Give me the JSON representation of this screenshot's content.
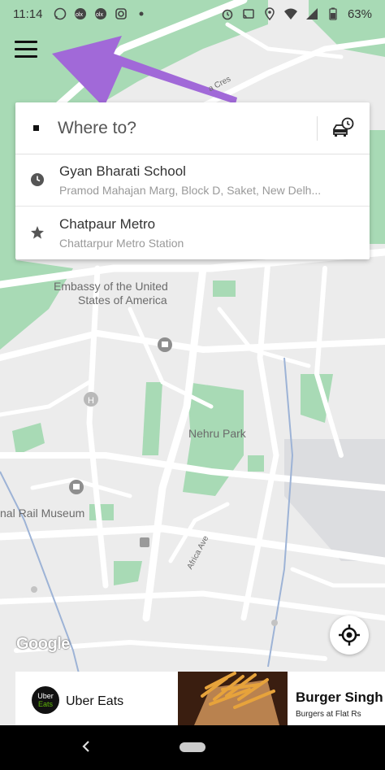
{
  "status_bar": {
    "time": "11:14",
    "battery": "63%",
    "left_icons": [
      "whatsapp-icon",
      "olx-icon",
      "olx-icon",
      "instagram-icon",
      "dot-icon"
    ],
    "right_icons": [
      "alarm-icon",
      "cast-icon",
      "location-icon",
      "wifi-icon",
      "signal-icon",
      "battery-icon"
    ]
  },
  "search": {
    "placeholder": "Where to?"
  },
  "recent_places": [
    {
      "icon": "clock-icon",
      "title": "Gyan Bharati School",
      "subtitle": "Pramod Mahajan Marg, Block D, Saket, New Delh..."
    },
    {
      "icon": "star-icon",
      "title": "Chatpaur Metro",
      "subtitle": "Chattarpur Metro Station"
    }
  ],
  "map_labels": {
    "road_cres": "a Cres",
    "embassy_line1": "Embassy of the United",
    "embassy_line2": "States of America",
    "park": "Nehru Park",
    "museum": "nal Rail Museum",
    "africa_ave": "Africa Ave",
    "google": "Google"
  },
  "promo": {
    "logo_line1": "Uber",
    "logo_line2": "Eats",
    "brand": "Uber Eats",
    "restaurant": "Burger Singh",
    "restaurant_sub": "Burgers at Flat Rs"
  },
  "colors": {
    "map_bg": "#ececec",
    "park_green": "#a8dab5",
    "road": "#ffffff",
    "annotation_purple": "#a169d8"
  }
}
